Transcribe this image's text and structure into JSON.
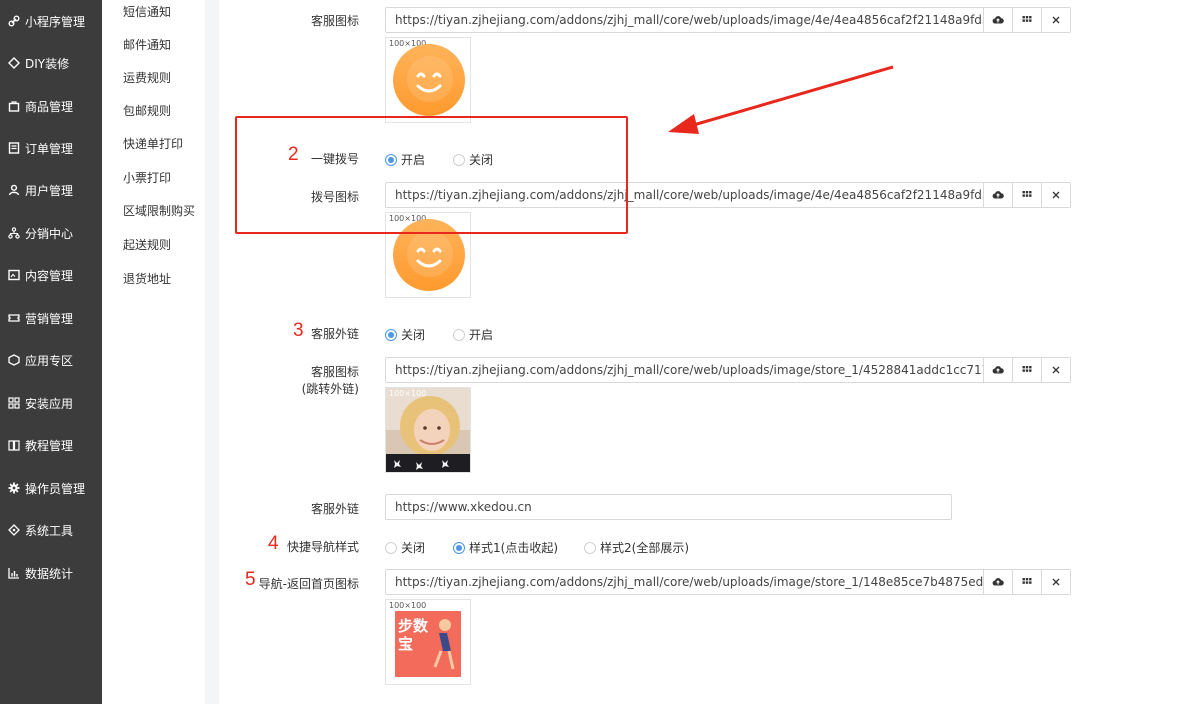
{
  "sidebar": {
    "items": [
      {
        "label": "小程序管理",
        "icon": "link-icon"
      },
      {
        "label": "DIY装修",
        "icon": "diamond-icon"
      },
      {
        "label": "商品管理",
        "icon": "bag-icon"
      },
      {
        "label": "订单管理",
        "icon": "list-icon"
      },
      {
        "label": "用户管理",
        "icon": "user-icon"
      },
      {
        "label": "分销中心",
        "icon": "network-icon"
      },
      {
        "label": "内容管理",
        "icon": "image-icon"
      },
      {
        "label": "营销管理",
        "icon": "ticket-icon"
      },
      {
        "label": "应用专区",
        "icon": "cube-icon"
      },
      {
        "label": "安装应用",
        "icon": "grid-icon"
      },
      {
        "label": "教程管理",
        "icon": "book-icon"
      },
      {
        "label": "操作员管理",
        "icon": "gear-icon"
      },
      {
        "label": "系统工具",
        "icon": "tool-icon"
      },
      {
        "label": "数据统计",
        "icon": "chart-icon"
      }
    ]
  },
  "subbar": {
    "items": [
      "短信通知",
      "邮件通知",
      "运费规则",
      "包邮规则",
      "快递单打印",
      "小票打印",
      "区域限制购买",
      "起送规则",
      "退货地址"
    ]
  },
  "form": {
    "kefu_icon": {
      "label": "客服图标",
      "value": "https://tiyan.zjhejiang.com/addons/zjhj_mall/core/web/uploads/image/4e/4ea4856caf2f21148a9fd30eb24c328",
      "thumb_size": "100×100"
    },
    "dial": {
      "number": "2",
      "label": "一键拨号",
      "options": [
        "开启",
        "关闭"
      ],
      "selected": 0
    },
    "dial_icon": {
      "label": "拨号图标",
      "value": "https://tiyan.zjhejiang.com/addons/zjhj_mall/core/web/uploads/image/4e/4ea4856caf2f21148a9fd30eb24c328",
      "thumb_size": "100×100"
    },
    "kefu_link_switch": {
      "number": "3",
      "label": "客服外链",
      "options": [
        "关闭",
        "开启"
      ],
      "selected": 0
    },
    "kefu_link_icon": {
      "label_line1": "客服图标",
      "label_line2": "(跳转外链)",
      "value": "https://tiyan.zjhejiang.com/addons/zjhj_mall/core/web/uploads/image/store_1/4528841addc1cc717226a12c6",
      "thumb_size": "100×100"
    },
    "kefu_link": {
      "label": "客服外链",
      "value": "https://www.xkedou.cn"
    },
    "nav_style": {
      "number": "4",
      "label": "快捷导航样式",
      "options": [
        "关闭",
        "样式1(点击收起)",
        "样式2(全部展示)"
      ],
      "selected": 1
    },
    "home_icon": {
      "number": "5",
      "label": "导航-返回首页图标",
      "value": "https://tiyan.zjhejiang.com/addons/zjhj_mall/core/web/uploads/image/store_1/148e85ce7b4875ed47718115C",
      "thumb_size": "100×100",
      "thumb_text": "步数宝"
    }
  },
  "colors": {
    "sidebar_bg": "#3c3c3c",
    "accent": "#4a96e8",
    "annotation": "#e8281c"
  }
}
